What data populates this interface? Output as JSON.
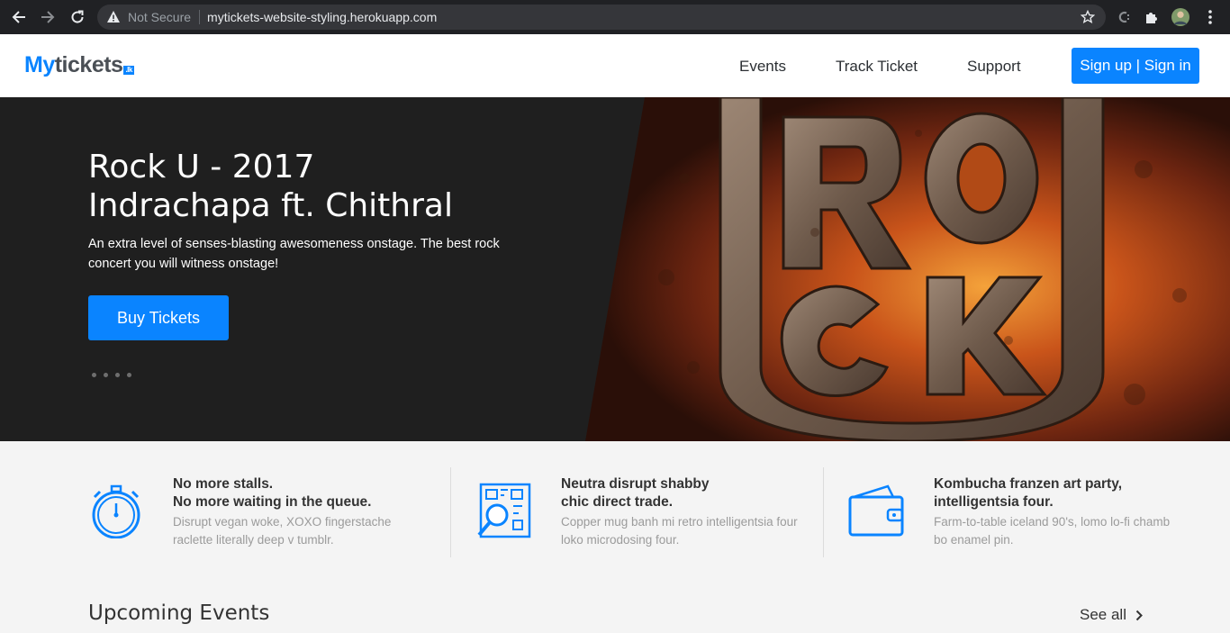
{
  "browser": {
    "security_label": "Not Secure",
    "url": "mytickets-website-styling.herokuapp.com"
  },
  "site": {
    "logo": {
      "part1": "My",
      "part2": "tickets",
      "badge": ".lk"
    },
    "nav": [
      {
        "label": "Events"
      },
      {
        "label": "Track Ticket"
      },
      {
        "label": "Support"
      }
    ],
    "auth_button": "Sign up | Sign in"
  },
  "hero": {
    "title_line1": "Rock U - 2017",
    "title_line2": "Indrachapa ft. Chithral",
    "description": "An extra level of senses-blasting awesomeness onstage. The best rock concert you will witness onstage!",
    "cta": "Buy Tickets",
    "slide_count": 4,
    "art_text": "ROCK U"
  },
  "features": [
    {
      "icon": "stopwatch-icon",
      "title_line1": "No more stalls.",
      "title_line2": "No more waiting in the queue.",
      "description": "Disrupt vegan woke, XOXO fingerstache raclette literally deep v tumblr."
    },
    {
      "icon": "qr-scan-icon",
      "title_line1": "Neutra disrupt shabby",
      "title_line2": "chic direct trade.",
      "description": "Copper mug banh mi retro intelligentsia four loko microdosing four."
    },
    {
      "icon": "wallet-icon",
      "title_line1": "Kombucha franzen art party,",
      "title_line2": "intelligentsia four.",
      "description": "Farm-to-table iceland 90's, lomo lo-fi chamb bo enamel pin."
    }
  ],
  "upcoming": {
    "title": "Upcoming Events",
    "see_all": "See all"
  },
  "colors": {
    "accent": "#0a84ff",
    "hero_bg": "#1f1f1f",
    "text_dark": "#333333",
    "text_muted": "#9b9b9b"
  }
}
